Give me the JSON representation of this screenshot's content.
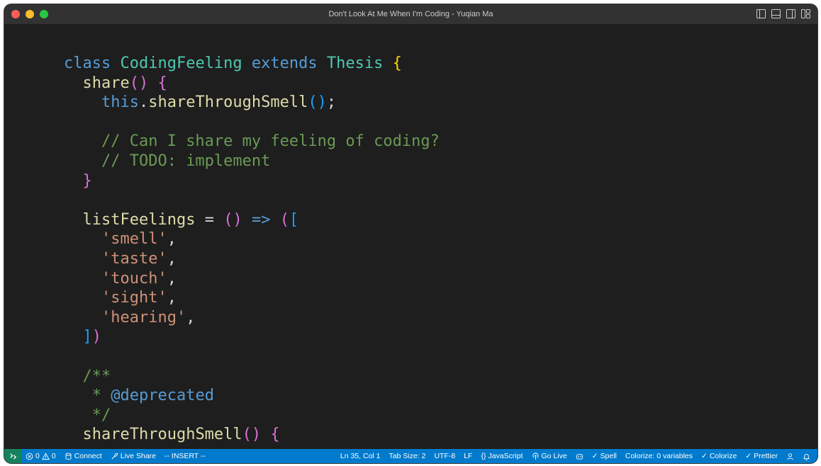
{
  "window": {
    "title": "Don't Look At Me When I'm Coding - Yuqian Ma"
  },
  "editor": {
    "lines": [
      [
        [
          "kw",
          "class"
        ],
        [
          "pun",
          " "
        ],
        [
          "cls",
          "CodingFeeling"
        ],
        [
          "pun",
          " "
        ],
        [
          "kw",
          "extends"
        ],
        [
          "pun",
          " "
        ],
        [
          "cls",
          "Thesis"
        ],
        [
          "pun",
          " "
        ],
        [
          "br1",
          "{"
        ]
      ],
      [
        [
          "pun",
          "  "
        ],
        [
          "fn",
          "share"
        ],
        [
          "br2",
          "()"
        ],
        [
          "pun",
          " "
        ],
        [
          "br2",
          "{"
        ]
      ],
      [
        [
          "pun",
          "    "
        ],
        [
          "kw",
          "this"
        ],
        [
          "pun",
          "."
        ],
        [
          "fn",
          "shareThroughSmell"
        ],
        [
          "br3",
          "()"
        ],
        [
          "pun",
          ";"
        ]
      ],
      [
        [
          "pun",
          ""
        ]
      ],
      [
        [
          "pun",
          "    "
        ],
        [
          "cm",
          "// Can I share my feeling of coding?"
        ]
      ],
      [
        [
          "pun",
          "    "
        ],
        [
          "cm",
          "// TODO: implement"
        ]
      ],
      [
        [
          "pun",
          "  "
        ],
        [
          "br2",
          "}"
        ]
      ],
      [
        [
          "pun",
          ""
        ]
      ],
      [
        [
          "pun",
          "  "
        ],
        [
          "fn",
          "listFeelings"
        ],
        [
          "pun",
          " = "
        ],
        [
          "br2",
          "()"
        ],
        [
          "pun",
          " "
        ],
        [
          "op",
          "=>"
        ],
        [
          "pun",
          " "
        ],
        [
          "br2",
          "("
        ],
        [
          "br3",
          "["
        ]
      ],
      [
        [
          "pun",
          "    "
        ],
        [
          "str",
          "'smell'"
        ],
        [
          "pun",
          ","
        ]
      ],
      [
        [
          "pun",
          "    "
        ],
        [
          "str",
          "'taste'"
        ],
        [
          "pun",
          ","
        ]
      ],
      [
        [
          "pun",
          "    "
        ],
        [
          "str",
          "'touch'"
        ],
        [
          "pun",
          ","
        ]
      ],
      [
        [
          "pun",
          "    "
        ],
        [
          "str",
          "'sight'"
        ],
        [
          "pun",
          ","
        ]
      ],
      [
        [
          "pun",
          "    "
        ],
        [
          "str",
          "'hearing'"
        ],
        [
          "pun",
          ","
        ]
      ],
      [
        [
          "pun",
          "  "
        ],
        [
          "br3",
          "]"
        ],
        [
          "br2",
          ")"
        ]
      ],
      [
        [
          "pun",
          ""
        ]
      ],
      [
        [
          "pun",
          "  "
        ],
        [
          "cm",
          "/**"
        ]
      ],
      [
        [
          "pun",
          "   "
        ],
        [
          "cm",
          "* "
        ],
        [
          "kw",
          "@deprecated"
        ]
      ],
      [
        [
          "pun",
          "   "
        ],
        [
          "cm",
          "*/"
        ]
      ],
      [
        [
          "pun",
          "  "
        ],
        [
          "fn",
          "shareThroughSmell"
        ],
        [
          "br2",
          "()"
        ],
        [
          "pun",
          " "
        ],
        [
          "br2",
          "{"
        ]
      ]
    ]
  },
  "statusbar": {
    "errors": "0",
    "warnings": "0",
    "connect": "Connect",
    "live_share": "Live Share",
    "mode": "-- INSERT --",
    "position": "Ln 35, Col 1",
    "tab_size": "Tab Size: 2",
    "encoding": "UTF-8",
    "eol": "LF",
    "language": "JavaScript",
    "go_live": "Go Live",
    "spell": "Spell",
    "colorize_vars": "Colorize: 0 variables",
    "colorize": "Colorize",
    "prettier": "Prettier"
  },
  "colors": {
    "statusbar_bg": "#007acc",
    "remote_bg": "#16825d",
    "editor_bg": "#1e1e1e",
    "keyword": "#569cd6",
    "class": "#4ec9b0",
    "function": "#dcdcaa",
    "string": "#ce9178",
    "comment": "#6a9955"
  },
  "icons": [
    "remote-icon",
    "error-icon",
    "warning-icon",
    "database-icon",
    "live-share-icon",
    "braces-icon",
    "broadcast-icon",
    "copilot-icon",
    "check-icon",
    "account-icon",
    "bell-icon"
  ]
}
